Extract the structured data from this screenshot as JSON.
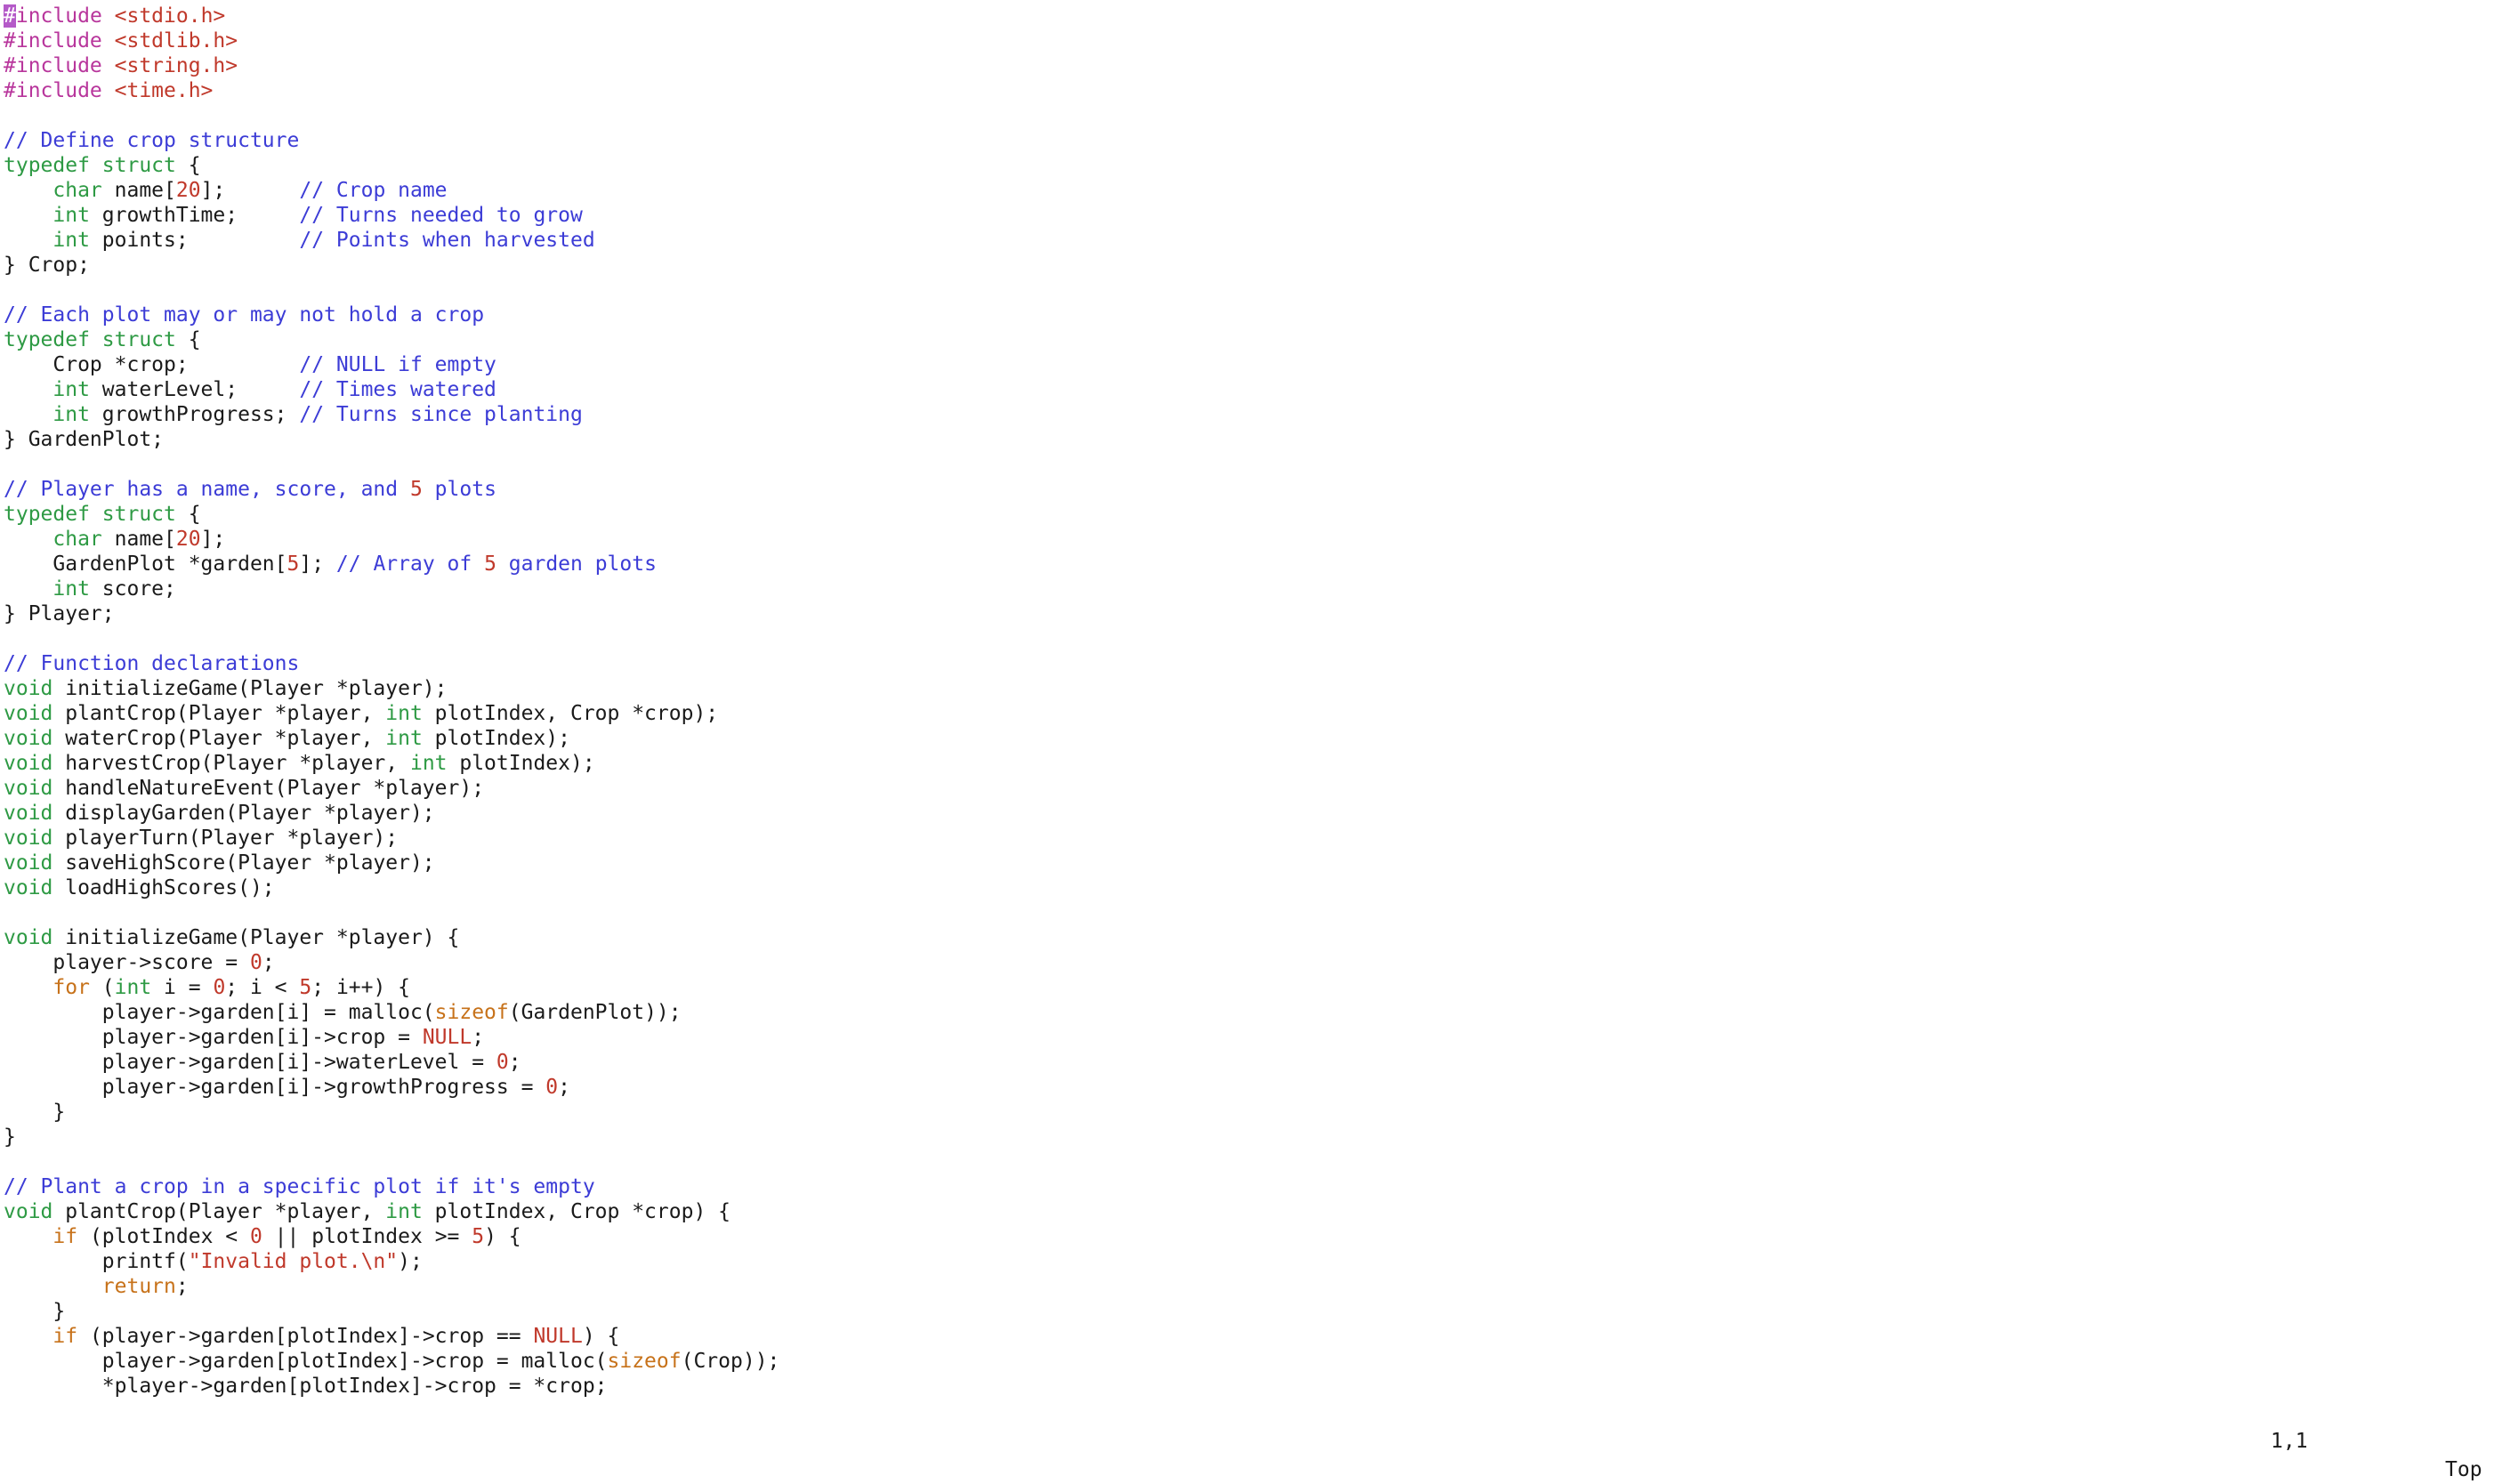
{
  "editor": {
    "lines": [
      [
        [
          "#",
          "cursor"
        ],
        [
          "include ",
          "pre"
        ],
        [
          "<stdio.h>",
          "inc"
        ]
      ],
      [
        [
          "#include ",
          "pre"
        ],
        [
          "<stdlib.h>",
          "inc"
        ]
      ],
      [
        [
          "#include ",
          "pre"
        ],
        [
          "<string.h>",
          "inc"
        ]
      ],
      [
        [
          "#include ",
          "pre"
        ],
        [
          "<time.h>",
          "inc"
        ]
      ],
      [],
      [
        [
          "// Define crop structure",
          "cmt"
        ]
      ],
      [
        [
          "typedef struct",
          "type"
        ],
        [
          " {",
          "plain"
        ]
      ],
      [
        [
          "    ",
          "plain"
        ],
        [
          "char",
          "type"
        ],
        [
          " name[",
          "plain"
        ],
        [
          "20",
          "num"
        ],
        [
          "];      ",
          "plain"
        ],
        [
          "// Crop name",
          "cmt"
        ]
      ],
      [
        [
          "    ",
          "plain"
        ],
        [
          "int",
          "type"
        ],
        [
          " growthTime;     ",
          "plain"
        ],
        [
          "// Turns needed to grow",
          "cmt"
        ]
      ],
      [
        [
          "    ",
          "plain"
        ],
        [
          "int",
          "type"
        ],
        [
          " points;         ",
          "plain"
        ],
        [
          "// Points when harvested",
          "cmt"
        ]
      ],
      [
        [
          "} Crop;",
          "plain"
        ]
      ],
      [],
      [
        [
          "// Each plot may or may not hold a crop",
          "cmt"
        ]
      ],
      [
        [
          "typedef struct",
          "type"
        ],
        [
          " {",
          "plain"
        ]
      ],
      [
        [
          "    Crop *crop;         ",
          "plain"
        ],
        [
          "// NULL if empty",
          "cmt"
        ]
      ],
      [
        [
          "    ",
          "plain"
        ],
        [
          "int",
          "type"
        ],
        [
          " waterLevel;     ",
          "plain"
        ],
        [
          "// Times watered",
          "cmt"
        ]
      ],
      [
        [
          "    ",
          "plain"
        ],
        [
          "int",
          "type"
        ],
        [
          " growthProgress; ",
          "plain"
        ],
        [
          "// Turns since planting",
          "cmt"
        ]
      ],
      [
        [
          "} GardenPlot;",
          "plain"
        ]
      ],
      [],
      [
        [
          "// Player has a name, score, and ",
          "cmt"
        ],
        [
          "5",
          "num"
        ],
        [
          " plots",
          "cmt"
        ]
      ],
      [
        [
          "typedef struct",
          "type"
        ],
        [
          " {",
          "plain"
        ]
      ],
      [
        [
          "    ",
          "plain"
        ],
        [
          "char",
          "type"
        ],
        [
          " name[",
          "plain"
        ],
        [
          "20",
          "num"
        ],
        [
          "];",
          "plain"
        ]
      ],
      [
        [
          "    GardenPlot *garden[",
          "plain"
        ],
        [
          "5",
          "num"
        ],
        [
          "]; ",
          "plain"
        ],
        [
          "// Array of ",
          "cmt"
        ],
        [
          "5",
          "num"
        ],
        [
          " garden plots",
          "cmt"
        ]
      ],
      [
        [
          "    ",
          "plain"
        ],
        [
          "int",
          "type"
        ],
        [
          " score;",
          "plain"
        ]
      ],
      [
        [
          "} Player;",
          "plain"
        ]
      ],
      [],
      [
        [
          "// Function declarations",
          "cmt"
        ]
      ],
      [
        [
          "void",
          "type"
        ],
        [
          " initializeGame(Player *player);",
          "plain"
        ]
      ],
      [
        [
          "void",
          "type"
        ],
        [
          " plantCrop(Player *player, ",
          "plain"
        ],
        [
          "int",
          "type"
        ],
        [
          " plotIndex, Crop *crop);",
          "plain"
        ]
      ],
      [
        [
          "void",
          "type"
        ],
        [
          " waterCrop(Player *player, ",
          "plain"
        ],
        [
          "int",
          "type"
        ],
        [
          " plotIndex);",
          "plain"
        ]
      ],
      [
        [
          "void",
          "type"
        ],
        [
          " harvestCrop(Player *player, ",
          "plain"
        ],
        [
          "int",
          "type"
        ],
        [
          " plotIndex);",
          "plain"
        ]
      ],
      [
        [
          "void",
          "type"
        ],
        [
          " handleNatureEvent(Player *player);",
          "plain"
        ]
      ],
      [
        [
          "void",
          "type"
        ],
        [
          " displayGarden(Player *player);",
          "plain"
        ]
      ],
      [
        [
          "void",
          "type"
        ],
        [
          " playerTurn(Player *player);",
          "plain"
        ]
      ],
      [
        [
          "void",
          "type"
        ],
        [
          " saveHighScore(Player *player);",
          "plain"
        ]
      ],
      [
        [
          "void",
          "type"
        ],
        [
          " loadHighScores();",
          "plain"
        ]
      ],
      [],
      [
        [
          "void",
          "type"
        ],
        [
          " initializeGame(Player *player) {",
          "plain"
        ]
      ],
      [
        [
          "    player->score = ",
          "plain"
        ],
        [
          "0",
          "num"
        ],
        [
          ";",
          "plain"
        ]
      ],
      [
        [
          "    ",
          "plain"
        ],
        [
          "for",
          "ctl"
        ],
        [
          " (",
          "plain"
        ],
        [
          "int",
          "type"
        ],
        [
          " i = ",
          "plain"
        ],
        [
          "0",
          "num"
        ],
        [
          "; i < ",
          "plain"
        ],
        [
          "5",
          "num"
        ],
        [
          "; i++) {",
          "plain"
        ]
      ],
      [
        [
          "        player->garden[i] = malloc(",
          "plain"
        ],
        [
          "sizeof",
          "ctl"
        ],
        [
          "(GardenPlot));",
          "plain"
        ]
      ],
      [
        [
          "        player->garden[i]->crop = ",
          "plain"
        ],
        [
          "NULL",
          "num"
        ],
        [
          ";",
          "plain"
        ]
      ],
      [
        [
          "        player->garden[i]->waterLevel = ",
          "plain"
        ],
        [
          "0",
          "num"
        ],
        [
          ";",
          "plain"
        ]
      ],
      [
        [
          "        player->garden[i]->growthProgress = ",
          "plain"
        ],
        [
          "0",
          "num"
        ],
        [
          ";",
          "plain"
        ]
      ],
      [
        [
          "    }",
          "plain"
        ]
      ],
      [
        [
          "}",
          "plain"
        ]
      ],
      [],
      [
        [
          "// Plant a crop in a specific plot if it's empty",
          "cmt"
        ]
      ],
      [
        [
          "void",
          "type"
        ],
        [
          " plantCrop(Player *player, ",
          "plain"
        ],
        [
          "int",
          "type"
        ],
        [
          " plotIndex, Crop *crop) {",
          "plain"
        ]
      ],
      [
        [
          "    ",
          "plain"
        ],
        [
          "if",
          "ctl"
        ],
        [
          " (plotIndex < ",
          "plain"
        ],
        [
          "0",
          "num"
        ],
        [
          " || plotIndex >= ",
          "plain"
        ],
        [
          "5",
          "num"
        ],
        [
          ") {",
          "plain"
        ]
      ],
      [
        [
          "        printf(",
          "plain"
        ],
        [
          "\"Invalid plot.\\n\"",
          "str"
        ],
        [
          ");",
          "plain"
        ]
      ],
      [
        [
          "        ",
          "plain"
        ],
        [
          "return",
          "ctl"
        ],
        [
          ";",
          "plain"
        ]
      ],
      [
        [
          "    }",
          "plain"
        ]
      ],
      [
        [
          "    ",
          "plain"
        ],
        [
          "if",
          "ctl"
        ],
        [
          " (player->garden[plotIndex]->crop == ",
          "plain"
        ],
        [
          "NULL",
          "num"
        ],
        [
          ") {",
          "plain"
        ]
      ],
      [
        [
          "        player->garden[plotIndex]->crop = malloc(",
          "plain"
        ],
        [
          "sizeof",
          "ctl"
        ],
        [
          "(Crop));",
          "plain"
        ]
      ],
      [
        [
          "        *player->garden[plotIndex]->crop = *crop;",
          "plain"
        ]
      ]
    ]
  },
  "status": {
    "position": "1,1",
    "scroll": "Top"
  }
}
